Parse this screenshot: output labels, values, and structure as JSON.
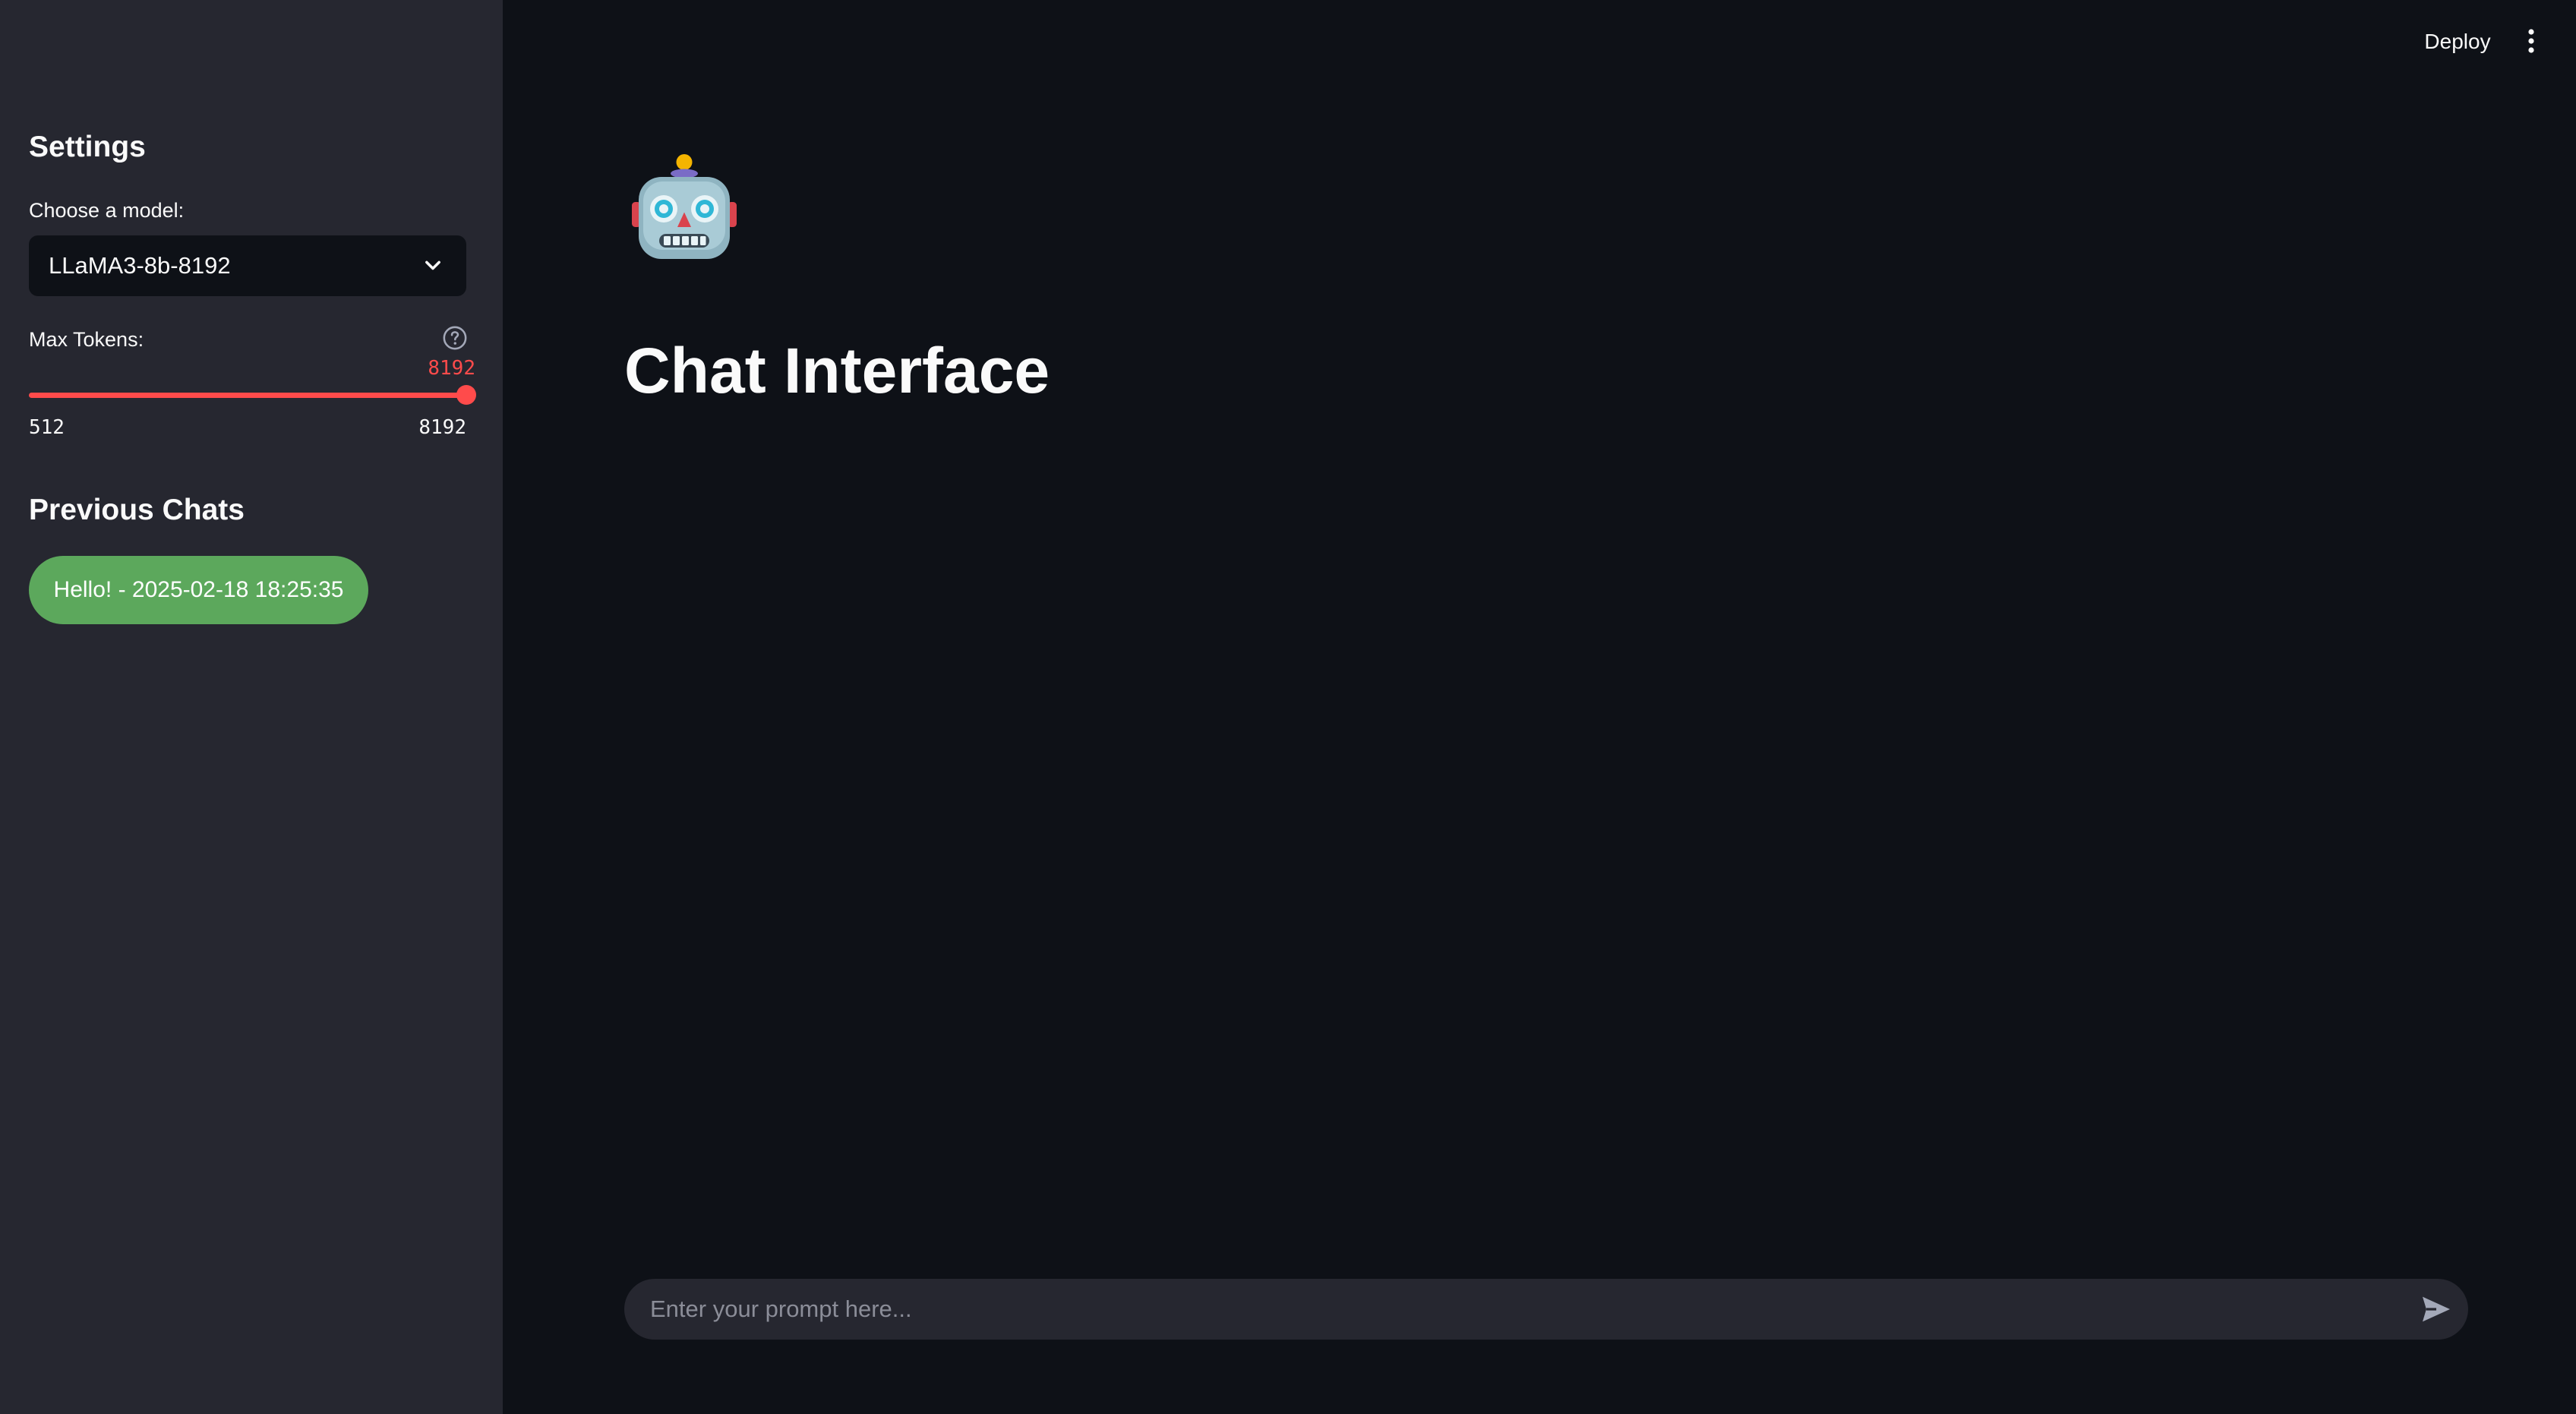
{
  "sidebar": {
    "settings_title": "Settings",
    "model_label": "Choose a model:",
    "model_value": "LLaMA3-8b-8192",
    "tokens_label": "Max Tokens:",
    "tokens_value": "8192",
    "tokens_min": "512",
    "tokens_max": "8192",
    "tokens_fraction": 1.0,
    "help_icon": "question-circle-icon",
    "previous_chats_title": "Previous Chats",
    "previous_chats": [
      {
        "label": "Hello! - 2025-02-18 18:25:35"
      }
    ]
  },
  "header": {
    "deploy_label": "Deploy",
    "menu_icon": "kebab-menu-icon"
  },
  "main": {
    "icon": "robot-icon",
    "title": "Chat Interface",
    "prompt_placeholder": "Enter your prompt here...",
    "send_icon": "send-icon"
  },
  "colors": {
    "main_background": "#0e1117",
    "sidebar_background": "#262730",
    "accent": "#ff4b4b",
    "chat_button": "#5ca85c",
    "text": "#fafafa"
  }
}
